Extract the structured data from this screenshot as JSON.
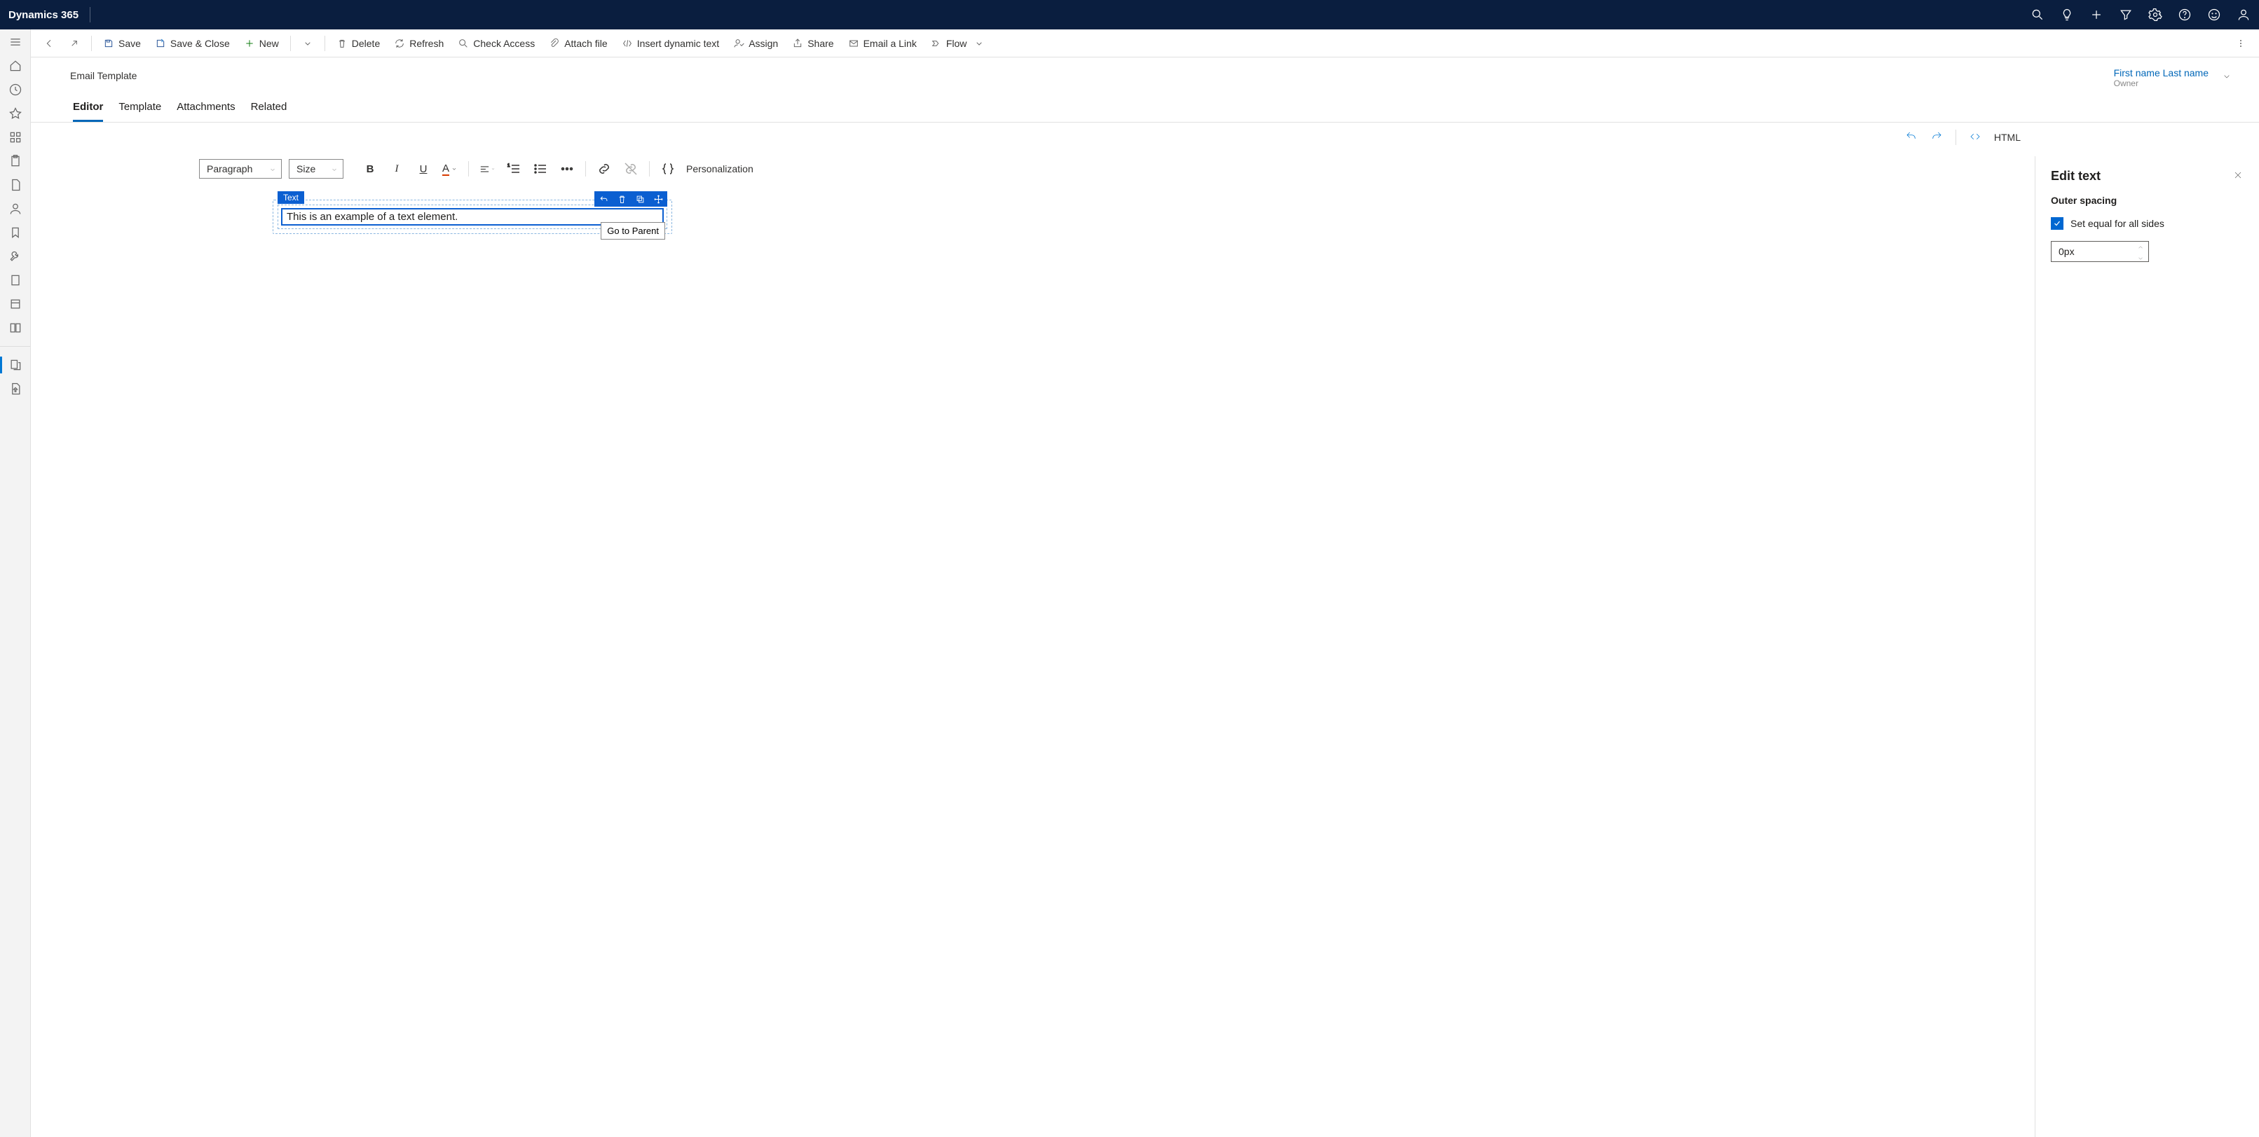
{
  "app_title": "Dynamics 365",
  "commands": {
    "save": "Save",
    "save_close": "Save & Close",
    "new": "New",
    "delete": "Delete",
    "refresh": "Refresh",
    "check_access": "Check Access",
    "attach": "Attach file",
    "insert_dynamic": "Insert dynamic text",
    "assign": "Assign",
    "share": "Share",
    "email_link": "Email a Link",
    "flow": "Flow"
  },
  "record": {
    "subtitle": "Email Template",
    "owner_name": "First name Last name",
    "owner_label": "Owner"
  },
  "tabs": [
    "Editor",
    "Template",
    "Attachments",
    "Related"
  ],
  "active_tab": "Editor",
  "html_button": "HTML",
  "format_toolbar": {
    "paragraph": "Paragraph",
    "size": "Size",
    "personalization": "Personalization"
  },
  "canvas": {
    "chip": "Text",
    "text_content": "This is an example of a text element.",
    "tooltip": "Go to Parent"
  },
  "rpanel": {
    "title": "Edit text",
    "outer_spacing": "Outer spacing",
    "equal_sides": "Set equal for all sides",
    "value": "0px"
  }
}
